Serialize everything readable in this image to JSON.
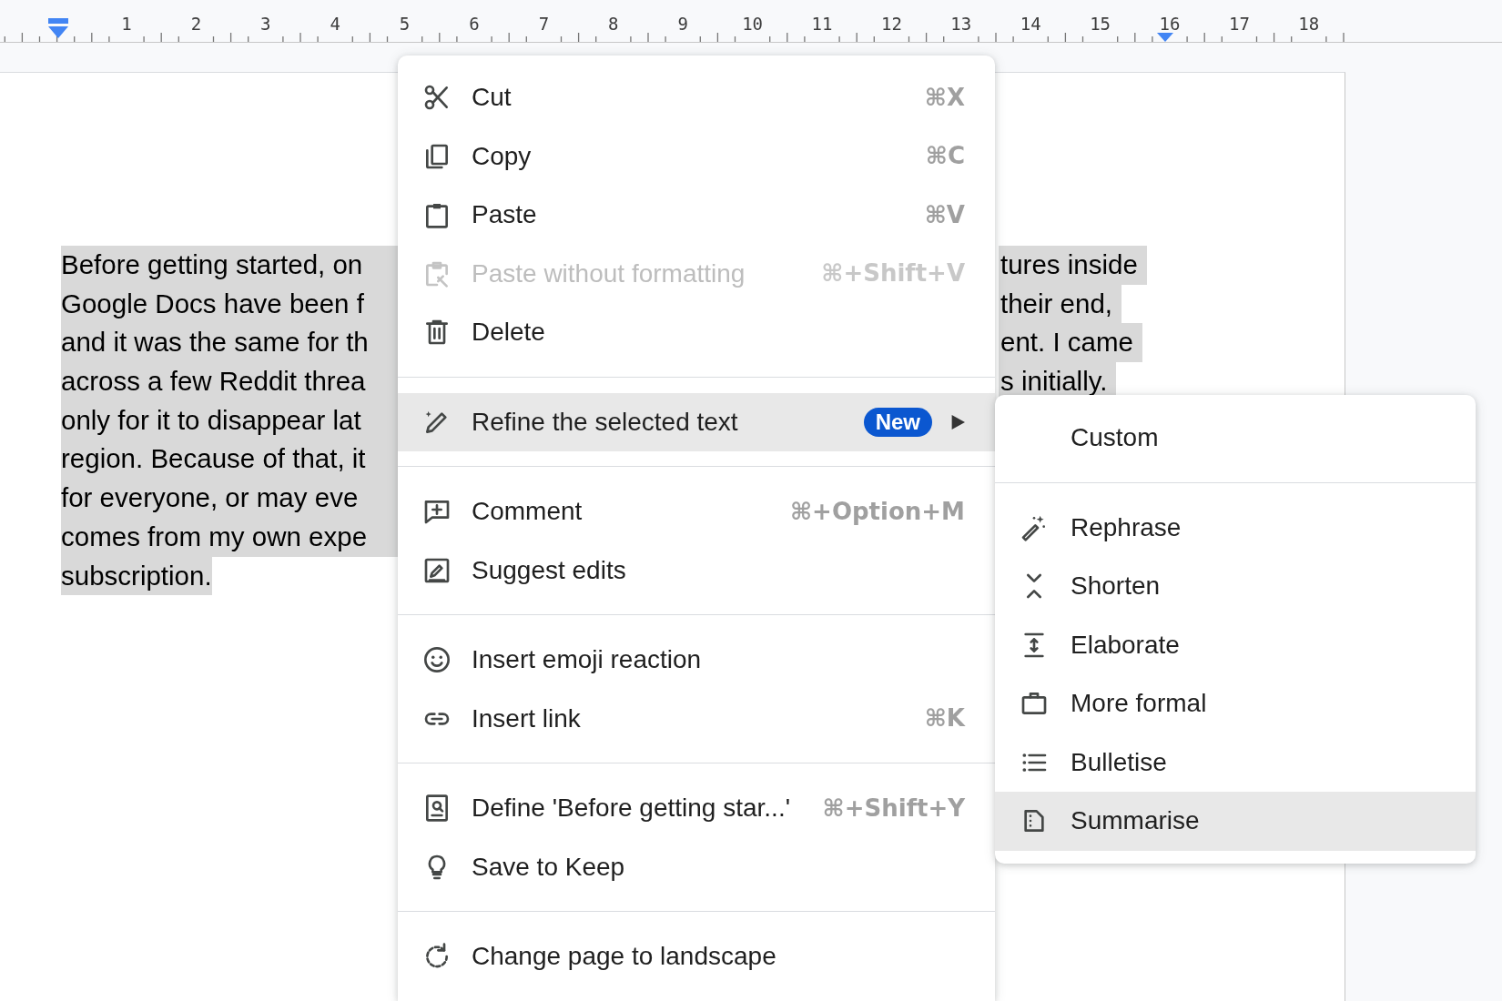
{
  "ruler": {
    "labels": [
      "1",
      "2",
      "3",
      "4",
      "5",
      "6",
      "7",
      "8",
      "9",
      "10",
      "11",
      "12",
      "13",
      "14",
      "15",
      "16",
      "17",
      "18"
    ]
  },
  "document": {
    "lines": [
      {
        "left": "Before getting started, on",
        "right": "tures inside",
        "continues": true
      },
      {
        "left": "Google Docs have been f",
        "right": "their end,",
        "continues": true
      },
      {
        "left": "and it was the same for th",
        "right": "ent. I came",
        "continues": true
      },
      {
        "left": "across a few Reddit threa",
        "right": "s initially.",
        "continues": true
      },
      {
        "left": "only for it to disappear lat",
        "continues": true
      },
      {
        "left": "region. Because of that, it",
        "continues": true
      },
      {
        "left": "for everyone, or may eve",
        "continues": true
      },
      {
        "left": "comes from my own expe",
        "continues": true
      },
      {
        "left": "subscription.",
        "continues": false
      }
    ]
  },
  "context_menu": {
    "groups": [
      [
        {
          "kind": "command",
          "label": "Cut",
          "shortcut": "⌘X",
          "disabled": false,
          "selected": false
        },
        {
          "kind": "command",
          "label": "Copy",
          "shortcut": "⌘C",
          "disabled": false,
          "selected": false
        },
        {
          "kind": "command",
          "label": "Paste",
          "shortcut": "⌘V",
          "disabled": false,
          "selected": false
        },
        {
          "kind": "command",
          "label": "Paste without formatting",
          "shortcut": "⌘+Shift+V",
          "disabled": true,
          "selected": false
        },
        {
          "kind": "command",
          "label": "Delete",
          "disabled": false,
          "selected": false
        }
      ],
      [
        {
          "kind": "submenu",
          "label": "Refine the selected text",
          "badge": "New",
          "disabled": false,
          "selected": true
        }
      ],
      [
        {
          "kind": "command",
          "label": "Comment",
          "shortcut": "⌘+Option+M",
          "disabled": false,
          "selected": false
        },
        {
          "kind": "command",
          "label": "Suggest edits",
          "disabled": false,
          "selected": false
        }
      ],
      [
        {
          "kind": "command",
          "label": "Insert emoji reaction",
          "disabled": false,
          "selected": false
        },
        {
          "kind": "command",
          "label": "Insert link",
          "shortcut": "⌘K",
          "disabled": false,
          "selected": false
        }
      ],
      [
        {
          "kind": "command",
          "label": "Define 'Before getting star...'",
          "shortcut": "⌘+Shift+Y",
          "disabled": false,
          "selected": false
        },
        {
          "kind": "command",
          "label": "Save to Keep",
          "disabled": false,
          "selected": false
        }
      ],
      [
        {
          "kind": "command",
          "label": "Change page to landscape",
          "disabled": false,
          "selected": false
        }
      ]
    ]
  },
  "submenu": {
    "groups": [
      [
        {
          "label": "Custom",
          "selected": false
        }
      ],
      [
        {
          "label": "Rephrase",
          "selected": false
        },
        {
          "label": "Shorten",
          "selected": false
        },
        {
          "label": "Elaborate",
          "selected": false
        },
        {
          "label": "More formal",
          "selected": false
        },
        {
          "label": "Bulletise",
          "selected": false
        },
        {
          "label": "Summarise",
          "selected": true
        }
      ]
    ]
  }
}
